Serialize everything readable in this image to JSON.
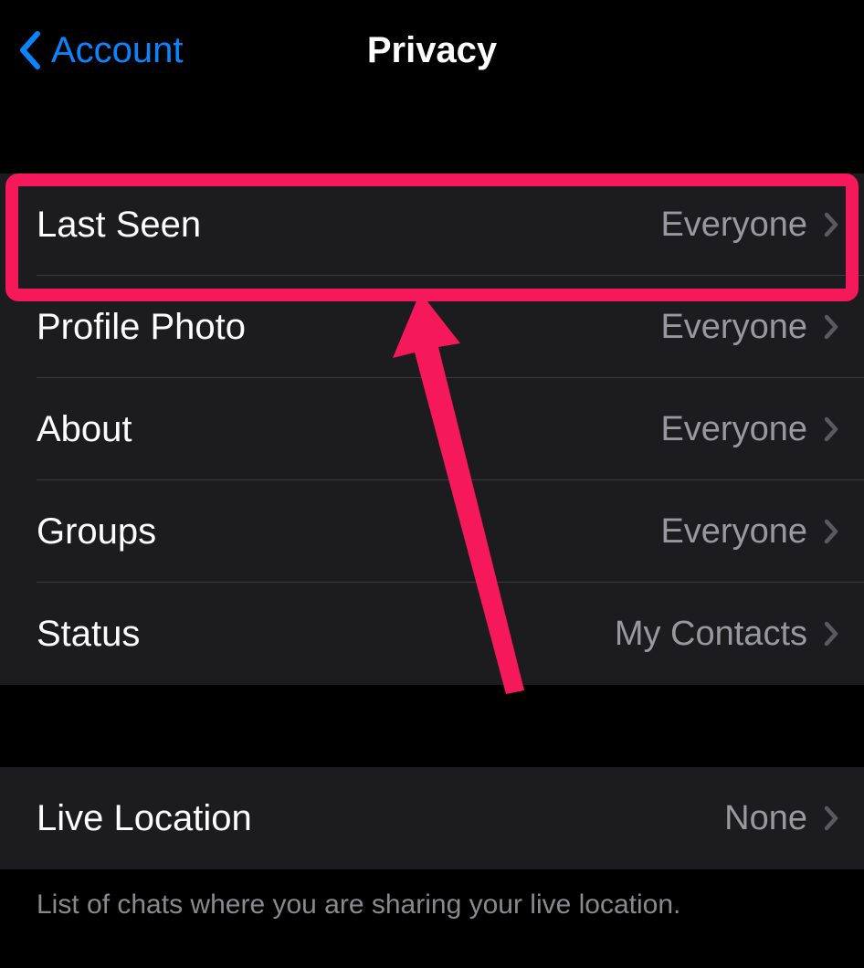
{
  "nav": {
    "back_label": "Account",
    "title": "Privacy"
  },
  "group1": {
    "rows": [
      {
        "label": "Last Seen",
        "value": "Everyone"
      },
      {
        "label": "Profile Photo",
        "value": "Everyone"
      },
      {
        "label": "About",
        "value": "Everyone"
      },
      {
        "label": "Groups",
        "value": "Everyone"
      },
      {
        "label": "Status",
        "value": "My Contacts"
      }
    ]
  },
  "group2": {
    "rows": [
      {
        "label": "Live Location",
        "value": "None"
      }
    ],
    "footer": "List of chats where you are sharing your live location."
  },
  "annotation": {
    "highlight_color": "#f5185a"
  }
}
